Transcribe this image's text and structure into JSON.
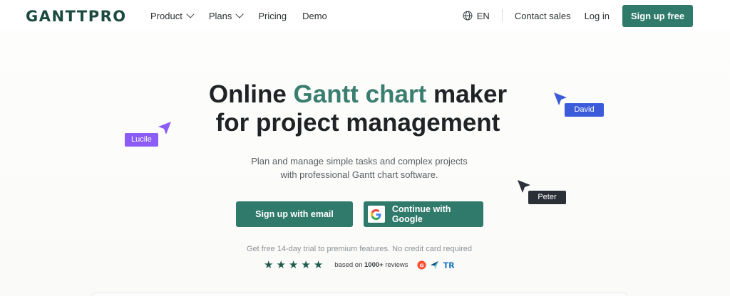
{
  "brand": {
    "logo": "GANTTPRO"
  },
  "nav": {
    "items": [
      {
        "label": "Product",
        "dropdown": true
      },
      {
        "label": "Plans",
        "dropdown": true
      },
      {
        "label": "Pricing",
        "dropdown": false
      },
      {
        "label": "Demo",
        "dropdown": false
      }
    ],
    "language": "EN",
    "contact_sales": "Contact sales",
    "log_in": "Log in",
    "sign_up": "Sign up free"
  },
  "hero": {
    "title_part1": "Online ",
    "title_accent": "Gantt chart",
    "title_part2": " maker",
    "title_line2": "for project management",
    "subtitle_line1": "Plan and manage simple tasks and complex projects",
    "subtitle_line2": "with professional Gantt chart software.",
    "btn_email": "Sign up with email",
    "btn_google": "Continue with Google",
    "trial_note": "Get free 14-day trial to premium features. No credit card required",
    "rating_stars": 5,
    "reviews_prefix": "based on ",
    "reviews_count": "1000+",
    "reviews_suffix": " reviews",
    "review_sites": [
      "g2-icon",
      "capterra-icon",
      "trustradius-icon"
    ]
  },
  "cursors": [
    {
      "name": "Lucile",
      "color": "#8b5cf6"
    },
    {
      "name": "David",
      "color": "#3b5bdb"
    },
    {
      "name": "Peter",
      "color": "#2b2f38"
    }
  ],
  "colors": {
    "accent": "#2f7a6b",
    "title_accent": "#3a7e6f",
    "logo": "#1b4a40",
    "stars": "#1f5a4e"
  }
}
